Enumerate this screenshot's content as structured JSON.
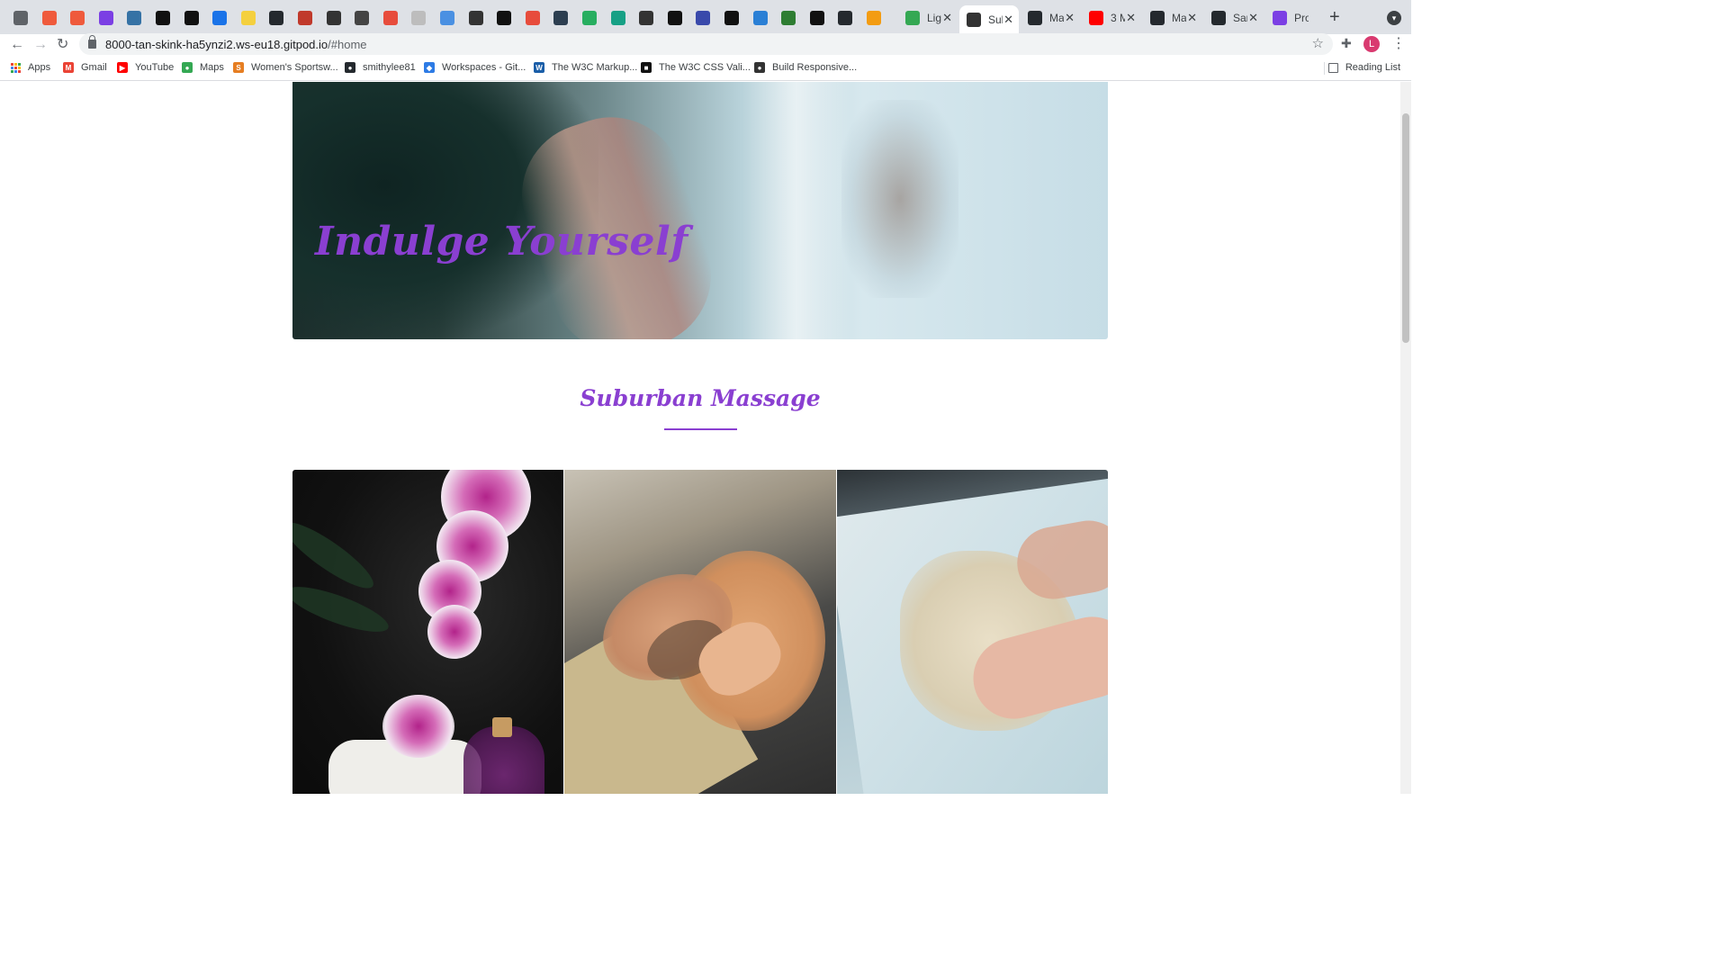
{
  "browser": {
    "tabs": [
      {
        "icon": "lightbulb-icon",
        "color": "#5f6368"
      },
      {
        "icon": "circle-icon",
        "color": "#ef5a3c"
      },
      {
        "icon": "circle-icon",
        "color": "#ef5a3c"
      },
      {
        "icon": "power-icon",
        "color": "#7b3fe4"
      },
      {
        "icon": "python-icon",
        "color": "#3572a5"
      },
      {
        "icon": "unsplash-icon",
        "color": "#111111"
      },
      {
        "icon": "c-logo-icon",
        "color": "#111111"
      },
      {
        "icon": "c-logo-icon",
        "color": "#1a73e8"
      },
      {
        "icon": "e-logo-icon",
        "color": "#f4d03f"
      },
      {
        "icon": "github-icon",
        "color": "#24292e"
      },
      {
        "icon": "square-icon",
        "color": "#c0392b"
      },
      {
        "icon": "cloud-icon",
        "color": "#333333"
      },
      {
        "icon": "t-logo-icon",
        "color": "#444444"
      },
      {
        "icon": "triangle-icon",
        "color": "#e74c3c"
      },
      {
        "icon": "image-icon",
        "color": "#bdbdbd"
      },
      {
        "icon": "heart-icon",
        "color": "#4a90e2"
      },
      {
        "icon": "globe-icon",
        "color": "#333333"
      },
      {
        "icon": "target-icon",
        "color": "#111111"
      },
      {
        "icon": "asterisk-icon",
        "color": "#e74c3c"
      },
      {
        "icon": "puzzle-icon",
        "color": "#2c3e50"
      },
      {
        "icon": "jsx-icon",
        "color": "#27ae60"
      },
      {
        "icon": "d-logo-icon",
        "color": "#16a085"
      },
      {
        "icon": "smiley-icon",
        "color": "#333333"
      },
      {
        "icon": "c-logo-icon",
        "color": "#111111"
      },
      {
        "icon": "grid-icon",
        "color": "#3949ab"
      },
      {
        "icon": "a-logo-icon",
        "color": "#111111"
      },
      {
        "icon": "vscode-icon",
        "color": "#2a7fd5"
      },
      {
        "icon": "w-logo-icon",
        "color": "#2e7d32"
      },
      {
        "icon": "o-logo-icon",
        "color": "#111111"
      },
      {
        "icon": "github-icon",
        "color": "#24292e"
      },
      {
        "icon": "g-logo-icon",
        "color": "#f39c12"
      }
    ],
    "wide_tabs": [
      {
        "title": "Lig",
        "icon": "code-icon",
        "color": "#34a853"
      },
      {
        "title": "Sul",
        "icon": "globe-icon",
        "color": "#333333",
        "active": true
      },
      {
        "title": "Ma",
        "icon": "github-icon",
        "color": "#24292e"
      },
      {
        "title": "3 M",
        "icon": "youtube-icon",
        "color": "#ff0000"
      },
      {
        "title": "Ma",
        "icon": "github-icon",
        "color": "#24292e"
      },
      {
        "title": "Sar",
        "icon": "github-icon",
        "color": "#24292e"
      },
      {
        "title": "Project",
        "icon": "doc-icon",
        "color": "#7b3fe4"
      }
    ],
    "close_glyph": "✕",
    "new_tab": "+",
    "url_host": "8000-tan-skink-ha5ynzi2.ws-eu18.gitpod.io",
    "url_path": "/#home",
    "profile_initial": "L",
    "bookmarks": [
      {
        "label": "Apps",
        "icon": "apps-icon"
      },
      {
        "label": "Gmail",
        "icon": "gmail-icon",
        "color": "#ea4335",
        "glyph": "M"
      },
      {
        "label": "YouTube",
        "icon": "youtube-icon",
        "color": "#ff0000",
        "glyph": "▶"
      },
      {
        "label": "Maps",
        "icon": "maps-pin-icon",
        "color": "#34a853",
        "glyph": "●"
      },
      {
        "label": "Women's Sportsw...",
        "icon": "s-logo-icon",
        "color": "#e67e22",
        "glyph": "S"
      },
      {
        "label": "smithylee81",
        "icon": "github-icon",
        "color": "#24292e",
        "glyph": "●"
      },
      {
        "label": "Workspaces - Git...",
        "icon": "gitpod-icon",
        "color": "#2d7be5",
        "glyph": "◆"
      },
      {
        "label": "The W3C Markup...",
        "icon": "w3c-icon",
        "color": "#1a5ea8",
        "glyph": "W"
      },
      {
        "label": "The W3C CSS Vali...",
        "icon": "css-validator-icon",
        "color": "#111111",
        "glyph": "■"
      },
      {
        "label": "Build Responsive...",
        "icon": "globe-icon",
        "color": "#333333",
        "glyph": "●"
      }
    ],
    "reading_list": "Reading List"
  },
  "page": {
    "hero_title": "Indulge Yourself",
    "section_title": "Suburban Massage",
    "accent": "#8a3fd1",
    "gallery": [
      {
        "alt": "orchids-spa-image"
      },
      {
        "alt": "neck-massage-image"
      },
      {
        "alt": "map-pointing-image"
      }
    ]
  }
}
